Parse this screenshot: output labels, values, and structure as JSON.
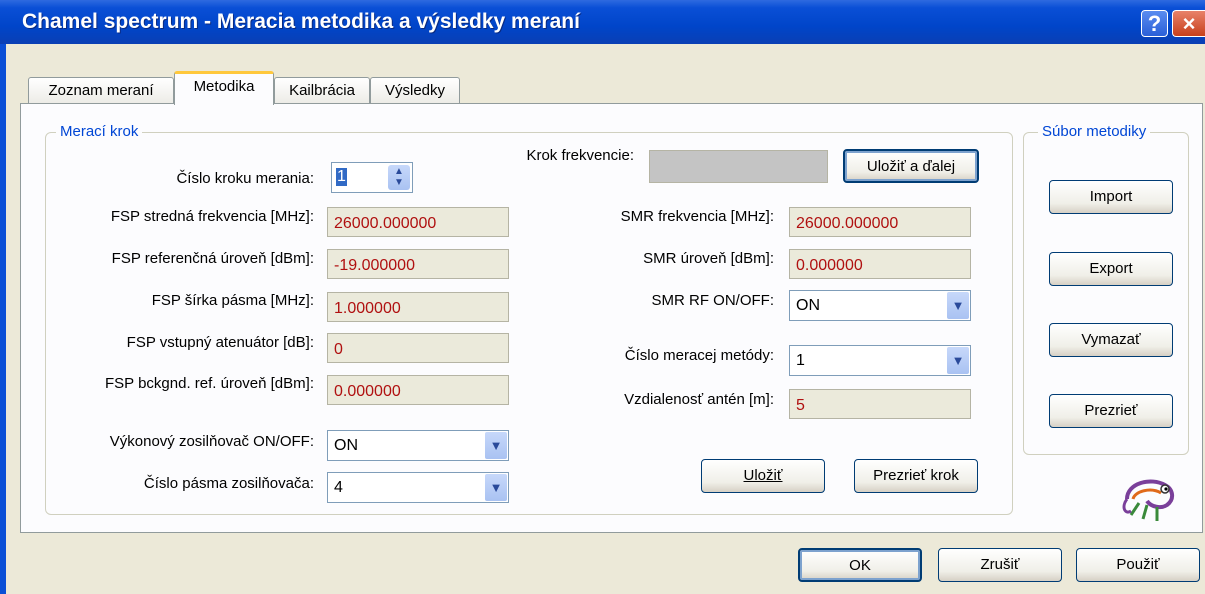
{
  "window": {
    "title": "Chamel spectrum - Meracia metodika a výsledky meraní",
    "help_glyph": "?",
    "close_glyph": "×"
  },
  "tabs": [
    {
      "label": "Zoznam meraní"
    },
    {
      "label": "Metodika"
    },
    {
      "label": "Kailbrácia"
    },
    {
      "label": "Výsledky"
    }
  ],
  "step_group": {
    "title": "Merací krok",
    "step_number": {
      "label": "Číslo kroku merania:",
      "value": "1"
    },
    "fsp_center": {
      "label": "FSP stredná frekvencia [MHz]:",
      "value": "26000.000000"
    },
    "fsp_ref": {
      "label": "FSP referenčná úroveň [dBm]:",
      "value": "-19.000000"
    },
    "fsp_bw": {
      "label": "FSP šírka pásma [MHz]:",
      "value": "1.000000"
    },
    "fsp_att": {
      "label": "FSP vstupný atenuátor [dB]:",
      "value": "0"
    },
    "fsp_bckgnd": {
      "label": "FSP bckgnd. ref. úroveň [dBm]:",
      "value": "0.000000"
    },
    "amp_on": {
      "label": "Výkonový zosilňovač ON/OFF:",
      "value": "ON"
    },
    "amp_band": {
      "label": "Číslo pásma zosilňovača:",
      "value": "4"
    },
    "freq_step": {
      "label": "Krok frekvencie:",
      "value": ""
    },
    "save_next_button": {
      "label": "Uložiť a ďalej"
    },
    "smr_freq": {
      "label": "SMR frekvencia [MHz]:",
      "value": "26000.000000"
    },
    "smr_level": {
      "label": "SMR úroveň [dBm]:",
      "value": "0.000000"
    },
    "smr_rf": {
      "label": "SMR RF ON/OFF:",
      "value": "ON"
    },
    "method_no": {
      "label": "Číslo meracej metódy:",
      "value": "1"
    },
    "antenna_dist": {
      "label": "Vzdialenosť antén [m]:",
      "value": "5"
    },
    "save_button": {
      "label": "Uložiť"
    },
    "view_step_button": {
      "label": "Prezrieť krok"
    }
  },
  "file_group": {
    "title": "Súbor metodiky",
    "import_button": {
      "label": "Import"
    },
    "export_button": {
      "label": "Export"
    },
    "delete_button": {
      "label": "Vymazať"
    },
    "view_button": {
      "label": "Prezrieť"
    }
  },
  "dialog_buttons": {
    "ok": {
      "label": "OK"
    },
    "cancel": {
      "label": "Zrušiť"
    },
    "apply": {
      "label": "Použiť"
    }
  },
  "colors": {
    "title_bar": "#0a4fd6",
    "legend_text": "#0046d5",
    "readonly_value_text": "#b01010",
    "dialog_bg": "#ece9d8"
  },
  "icons": {
    "spin": "spinner-arrows-icon",
    "dropdown": "chevron-down-icon",
    "mascot": "chameleon-icon"
  }
}
